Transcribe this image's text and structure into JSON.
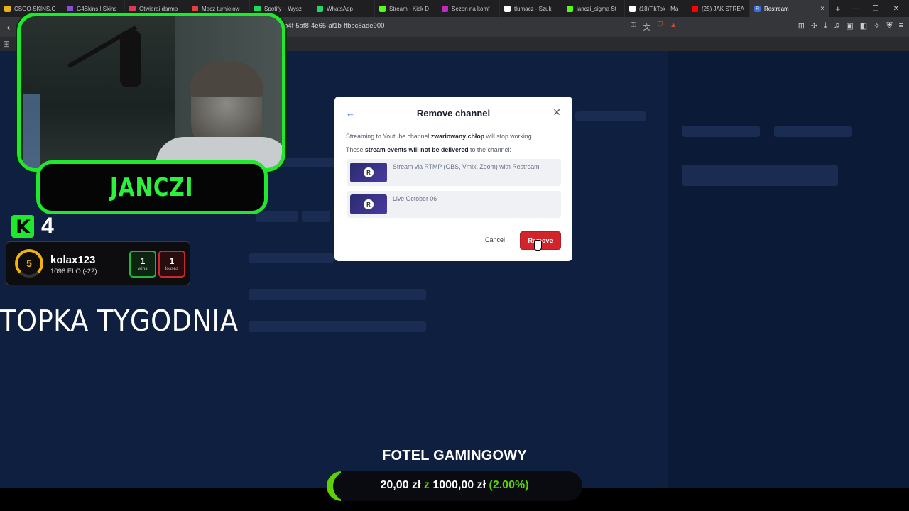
{
  "browser": {
    "tabs": [
      {
        "label": "CSGO-SKINS.C",
        "color": "#e8b21a"
      },
      {
        "label": "G4Skins | Skins",
        "color": "#8c4dd8"
      },
      {
        "label": "Otwieraj darmo",
        "color": "#d83a5a"
      },
      {
        "label": "Mecz turniejow",
        "color": "#e04040"
      },
      {
        "label": "Spotify – Wysz",
        "color": "#1ed760"
      },
      {
        "label": "WhatsApp",
        "color": "#25d366"
      },
      {
        "label": "Stream - Kick D",
        "color": "#53fc18"
      },
      {
        "label": "Sezon na komf",
        "color": "#c02ac0"
      },
      {
        "label": "tlumacz - Szuk",
        "color": "#ffffff"
      },
      {
        "label": "janczi_sigma St",
        "color": "#53fc18"
      },
      {
        "label": "(18)TikTok - Ma",
        "color": "#ffffff"
      },
      {
        "label": "(25) JAK STREA",
        "color": "#ff0000"
      }
    ],
    "active_tab": {
      "label": "Restream",
      "icon_letter": "R",
      "color": "#3b6fd8"
    },
    "url": "b4f-5af8-4e65-af1b-ffbbc8ade900"
  },
  "modal": {
    "title": "Remove channel",
    "desc_line1_prefix": "Streaming to Youtube channel ",
    "channel_name": "zwariowany chłop",
    "desc_line1_suffix": " will stop working.",
    "desc_line2_prefix": "These ",
    "desc_line2_strong": "stream events will not be delivered",
    "desc_line2_suffix": " to the channel:",
    "events": [
      {
        "label": "Stream via RTMP (OBS, Vmix, Zoom) with Restream",
        "thumb_letter": "R"
      },
      {
        "label": "Live October 06",
        "thumb_letter": "R"
      }
    ],
    "cancel_label": "Cancel",
    "remove_label": "Remove"
  },
  "overlay": {
    "streamer_name": "JANCZI",
    "kick_count": "4",
    "faceit": {
      "level": "5",
      "username": "kolax123",
      "elo": "1096 ELO (-22)",
      "wins": "1",
      "wins_label": "wins",
      "losses": "1",
      "losses_label": "losses"
    },
    "topka": "TOPKA TYGODNIA",
    "goal": {
      "title": "FOTEL GAMINGOWY",
      "current": "20,00 zł",
      "separator": "z",
      "target": "1000,00 zł",
      "percent": "(2.00%)",
      "progress_fraction": 0.02
    }
  }
}
